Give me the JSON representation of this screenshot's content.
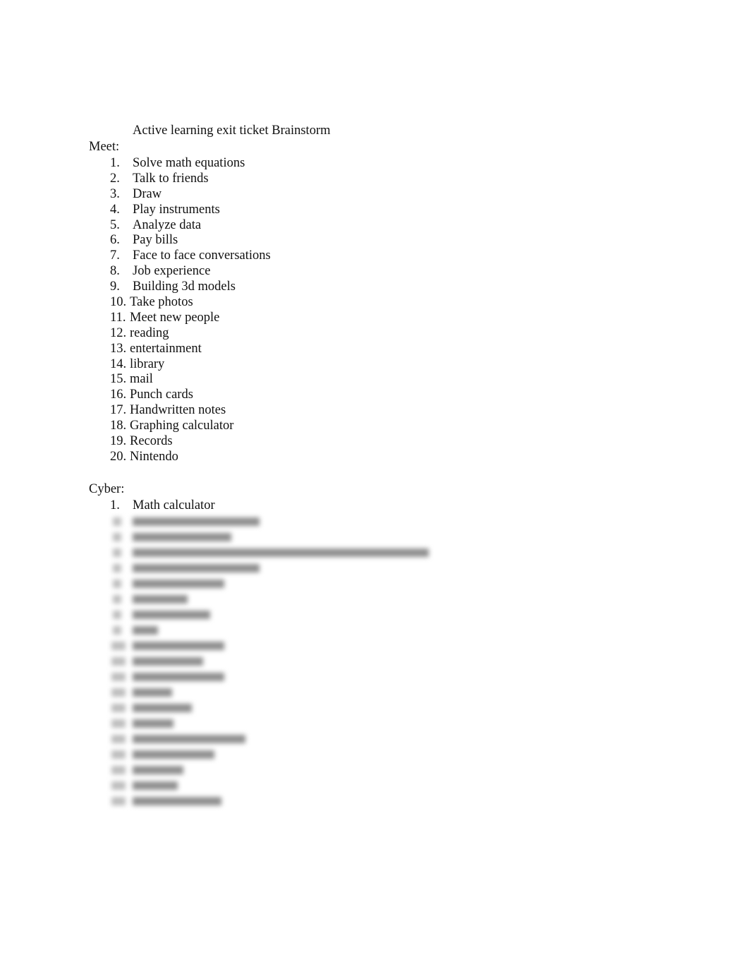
{
  "document": {
    "title": "Active learning exit ticket Brainstorm",
    "sections": {
      "meet": {
        "heading": "Meet:",
        "items": [
          {
            "num": "1.",
            "text": "Solve math equations"
          },
          {
            "num": "2.",
            "text": "Talk to friends"
          },
          {
            "num": "3.",
            "text": "Draw"
          },
          {
            "num": "4.",
            "text": "Play instruments"
          },
          {
            "num": "5.",
            "text": "Analyze data"
          },
          {
            "num": "6.",
            "text": "Pay bills"
          },
          {
            "num": "7.",
            "text": "Face to face conversations"
          },
          {
            "num": "8.",
            "text": "Job experience"
          },
          {
            "num": "9.",
            "text": "Building 3d models"
          },
          {
            "num": "10.",
            "text": "Take photos"
          },
          {
            "num": "11.",
            "text": "Meet new people"
          },
          {
            "num": "12.",
            "text": "reading"
          },
          {
            "num": "13.",
            "text": "entertainment"
          },
          {
            "num": "14.",
            "text": "library"
          },
          {
            "num": "15.",
            "text": "mail"
          },
          {
            "num": "16.",
            "text": "Punch cards"
          },
          {
            "num": "17.",
            "text": "Handwritten notes"
          },
          {
            "num": "18.",
            "text": "Graphing calculator"
          },
          {
            "num": "19.",
            "text": "Records"
          },
          {
            "num": "20.",
            "text": "Nintendo"
          }
        ]
      },
      "cyber": {
        "heading": "Cyber:",
        "items": [
          {
            "num": "1.",
            "text": "Math calculator"
          }
        ],
        "blurred_item_count": 19
      }
    }
  }
}
